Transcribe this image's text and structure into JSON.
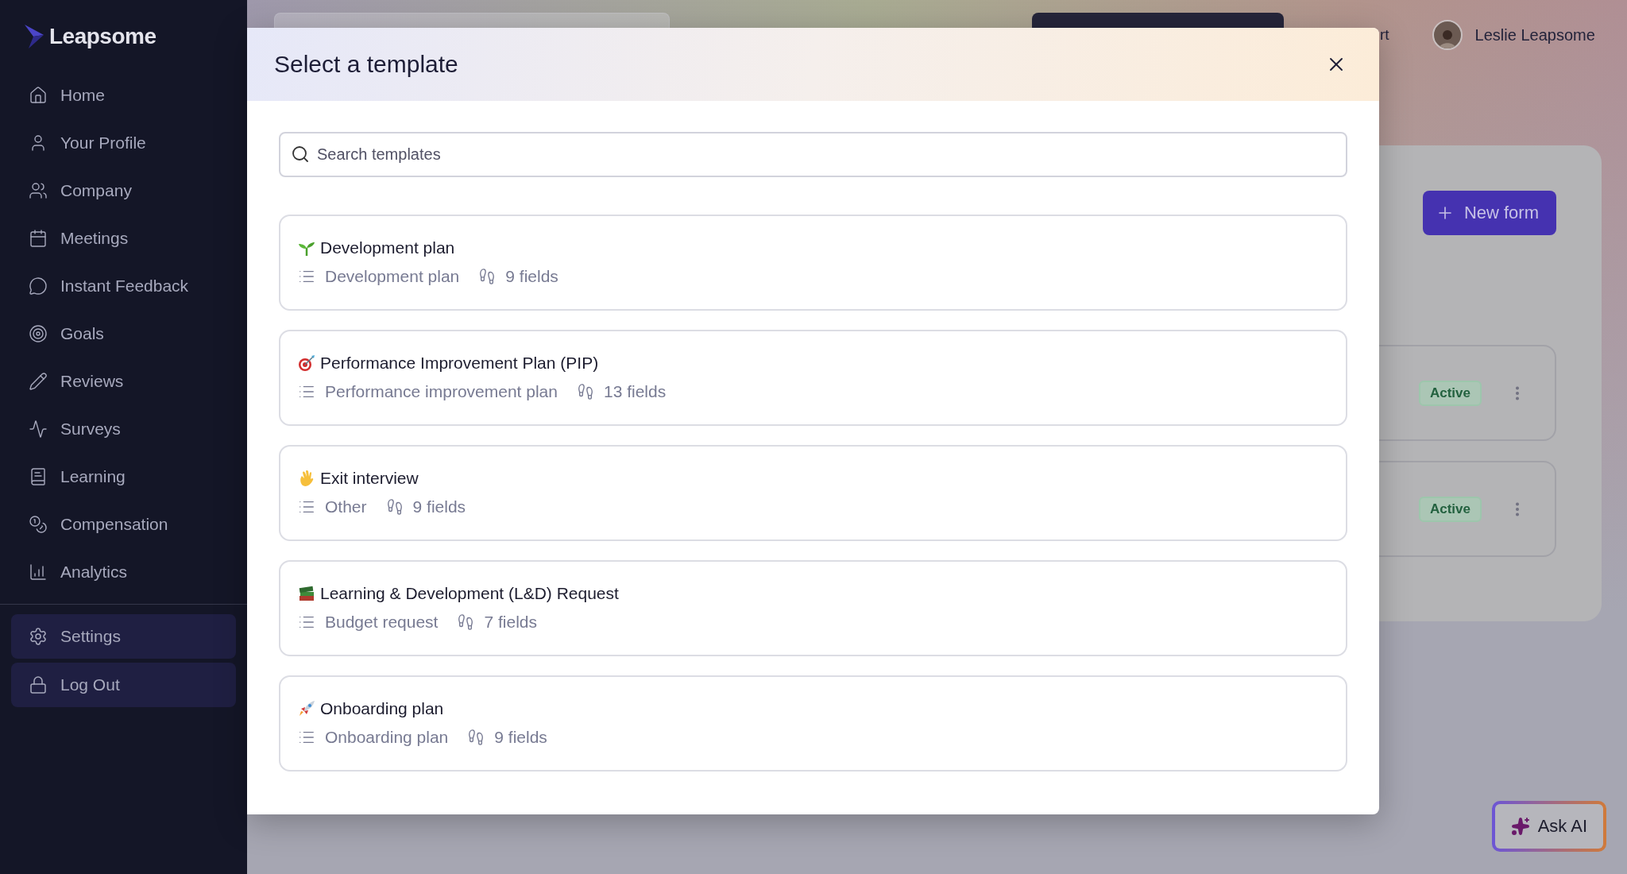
{
  "sidebar": {
    "logo": "Leapsome",
    "items": [
      {
        "label": "Home"
      },
      {
        "label": "Your Profile"
      },
      {
        "label": "Company"
      },
      {
        "label": "Meetings"
      },
      {
        "label": "Instant Feedback"
      },
      {
        "label": "Goals"
      },
      {
        "label": "Reviews"
      },
      {
        "label": "Surveys"
      },
      {
        "label": "Learning"
      },
      {
        "label": "Compensation"
      },
      {
        "label": "Analytics"
      }
    ],
    "bottom_items": [
      {
        "label": "Settings"
      },
      {
        "label": "Log Out"
      }
    ]
  },
  "topbar": {
    "partial_link": "rt",
    "user_name": "Leslie Leapsome"
  },
  "panel": {
    "new_form_button": "New form",
    "forms": [
      {
        "status": "Active"
      },
      {
        "status": "Active"
      }
    ]
  },
  "ask_ai_button": "Ask AI",
  "modal": {
    "title": "Select a template",
    "search": {
      "placeholder": "Search templates"
    },
    "templates": [
      {
        "title": "Development plan",
        "category": "Development plan",
        "fields": "9 fields"
      },
      {
        "title": "Performance Improvement Plan (PIP)",
        "category": "Performance improvement plan",
        "fields": "13 fields"
      },
      {
        "title": "Exit interview",
        "category": "Other",
        "fields": "9 fields"
      },
      {
        "title": "Learning & Development (L&D) Request",
        "category": "Budget request",
        "fields": "7 fields"
      },
      {
        "title": "Onboarding plan",
        "category": "Onboarding plan",
        "fields": "9 fields"
      }
    ]
  }
}
